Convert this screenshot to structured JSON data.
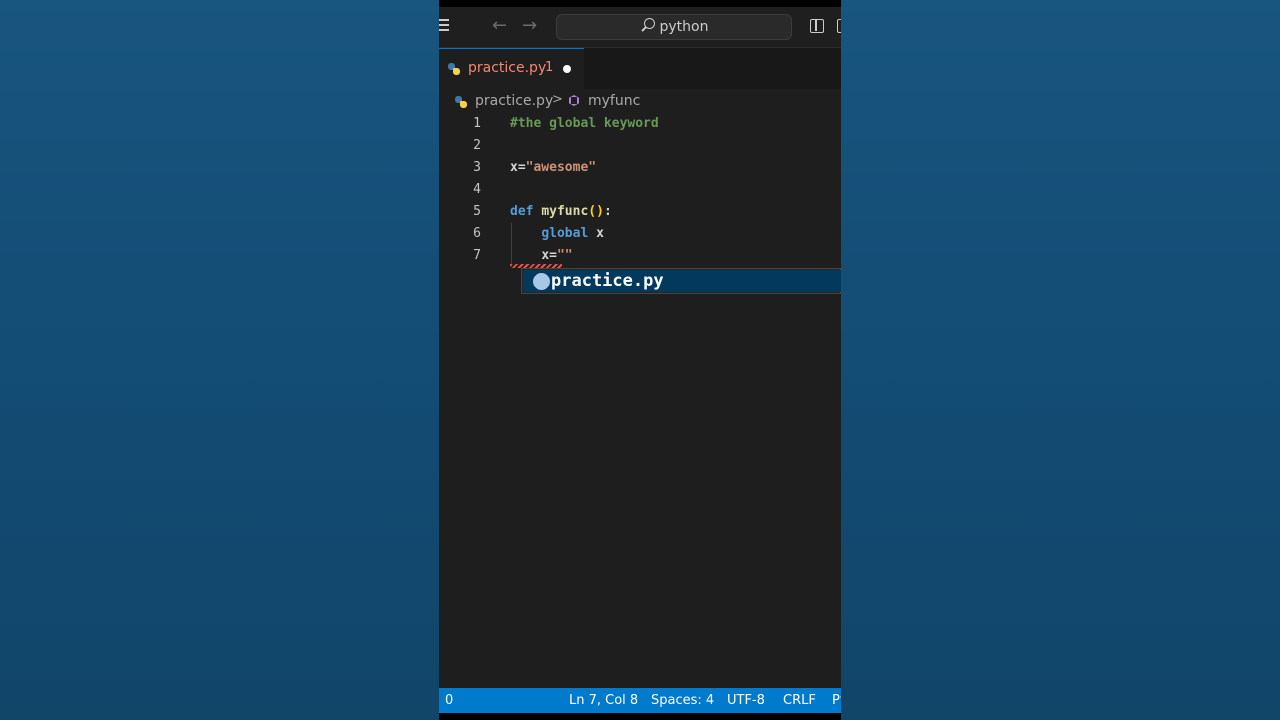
{
  "titlebar": {
    "search_text": "python"
  },
  "tab": {
    "label": "practice.py",
    "problem_count": "1"
  },
  "breadcrumb": {
    "file": "practice.py",
    "separator": ">",
    "symbol": "myfunc"
  },
  "editor": {
    "lines": [
      {
        "num": "1",
        "comment": "#the global keyword"
      },
      {
        "num": "2"
      },
      {
        "num": "3",
        "var": "x=",
        "str": "\"awesome\""
      },
      {
        "num": "4"
      },
      {
        "num": "5",
        "keyword": "def",
        "fn": "myfunc",
        "parens": "()",
        "colon": ":"
      },
      {
        "num": "6",
        "keyword": "global",
        "var": "x"
      },
      {
        "num": "7",
        "var": "x=",
        "str": "\"\""
      }
    ]
  },
  "suggestion": {
    "label": "practice.py"
  },
  "statusbar": {
    "problems": "0",
    "position": "Ln 7, Col 8",
    "spaces": "Spaces: 4",
    "encoding": "UTF-8",
    "eol": "CRLF",
    "language": "Py"
  },
  "colors": {
    "accent": "#007acc",
    "comment": "#6a9955",
    "keyword": "#569cd6",
    "function": "#dcdcaa",
    "string": "#ce9178",
    "error": "#f48771"
  },
  "icons": [
    "menu-icon",
    "back-arrow-icon",
    "forward-arrow-icon",
    "search-icon",
    "layout-icon",
    "python-icon",
    "chevron-right-icon",
    "symbol-method-icon",
    "file-icon"
  ]
}
